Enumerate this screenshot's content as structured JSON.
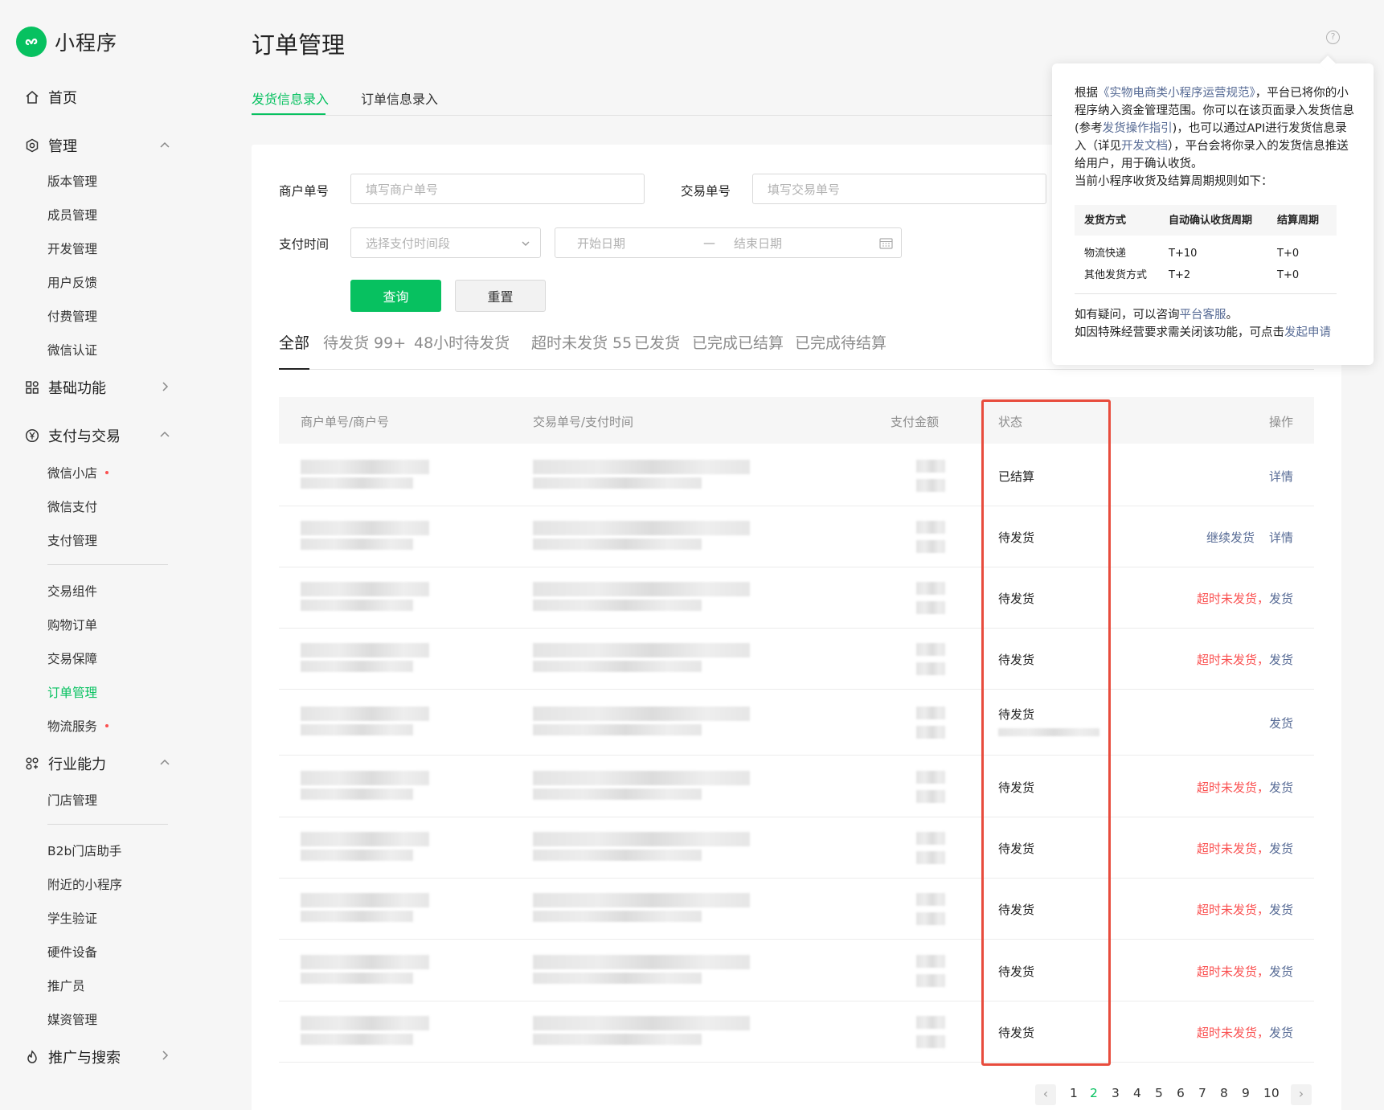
{
  "app": {
    "logo_text": "小程序",
    "page_title": "订单管理"
  },
  "nav": {
    "home": "首页",
    "manage": {
      "label": "管理",
      "items": [
        "版本管理",
        "成员管理",
        "开发管理",
        "用户反馈",
        "付费管理",
        "微信认证"
      ]
    },
    "basic": "基础功能",
    "pay": {
      "label": "支付与交易",
      "items": [
        "微信小店",
        "微信支付",
        "支付管理"
      ],
      "items2": [
        "交易组件",
        "购物订单",
        "交易保障",
        "订单管理",
        "物流服务"
      ]
    },
    "industry": {
      "label": "行业能力",
      "items": [
        "门店管理"
      ],
      "items2": [
        "B2b门店助手",
        "附近的小程序",
        "学生验证",
        "硬件设备",
        "推广员",
        "媒资管理"
      ]
    },
    "promo": "推广与搜索"
  },
  "tabs": {
    "ship": "发货信息录入",
    "order": "订单信息录入"
  },
  "form": {
    "merchant_label": "商户单号",
    "merchant_placeholder": "填写商户单号",
    "trade_label": "交易单号",
    "trade_placeholder": "填写交易单号",
    "paytime_label": "支付时间",
    "paytime_placeholder": "选择支付时间段",
    "start_date": "开始日期",
    "date_sep": "—",
    "end_date": "结束日期",
    "query": "查询",
    "reset": "重置"
  },
  "status_tabs": [
    "全部",
    "待发货 99+",
    "48小时待发货",
    "超时未发货 55",
    "已发货",
    "已完成已结算",
    "已完成待结算"
  ],
  "table": {
    "headers": {
      "merchant": "商户单号/商户号",
      "trade": "交易单号/支付时间",
      "amount": "支付金额",
      "status": "状态",
      "ops": "操作"
    },
    "rows": [
      {
        "status": "已结算",
        "red": "",
        "ops": [
          "详情"
        ]
      },
      {
        "status": "待发货",
        "red": "",
        "ops": [
          "继续发货",
          "详情"
        ]
      },
      {
        "status": "待发货",
        "red": "超时未发货，",
        "ops": [
          "发货"
        ]
      },
      {
        "status": "待发货",
        "red": "超时未发货，",
        "ops": [
          "发货"
        ]
      },
      {
        "status": "待发货",
        "red": "",
        "ops": [
          "发货"
        ]
      },
      {
        "status": "待发货",
        "red": "超时未发货，",
        "ops": [
          "发货"
        ]
      },
      {
        "status": "待发货",
        "red": "超时未发货，",
        "ops": [
          "发货"
        ]
      },
      {
        "status": "待发货",
        "red": "超时未发货，",
        "ops": [
          "发货"
        ]
      },
      {
        "status": "待发货",
        "red": "超时未发货，",
        "ops": [
          "发货"
        ]
      },
      {
        "status": "待发货",
        "red": "超时未发货，",
        "ops": [
          "发货"
        ]
      }
    ]
  },
  "pagination": {
    "pages": [
      "1",
      "2",
      "3",
      "4",
      "5",
      "6",
      "7",
      "8",
      "9",
      "10"
    ],
    "current": "2",
    "prev": "‹",
    "next": "›"
  },
  "popover": {
    "t1": "根据",
    "l1": "《实物电商类小程序运营规范》",
    "t2": "，平台已将你的小程序纳入资金管理范围。你可以在该页面录入发货信息(参考",
    "l2": "发货操作指引",
    "t3": ")，也可以通过API进行发货信息录入（详见",
    "l3": "开发文档",
    "t4": "），平台会将你录入的发货信息推送给用户，用于确认收货。",
    "t5": "当前小程序收货及结算周期规则如下：",
    "table_headers": [
      "发货方式",
      "自动确认收货周期",
      "结算周期"
    ],
    "table_rows": [
      [
        "物流快递",
        "T+10",
        "T+0"
      ],
      [
        "其他发货方式",
        "T+2",
        "T+0"
      ]
    ],
    "f1": "如有疑问，可以咨询",
    "fl1": "平台客服",
    "f2": "。",
    "f3": "如因特殊经营要求需关闭该功能，可点击",
    "fl2": "发起申请"
  },
  "colors": {
    "brand": "#07c160",
    "link": "#576b95",
    "danger": "#fa5151",
    "highlight_box": "#e84c3d"
  }
}
